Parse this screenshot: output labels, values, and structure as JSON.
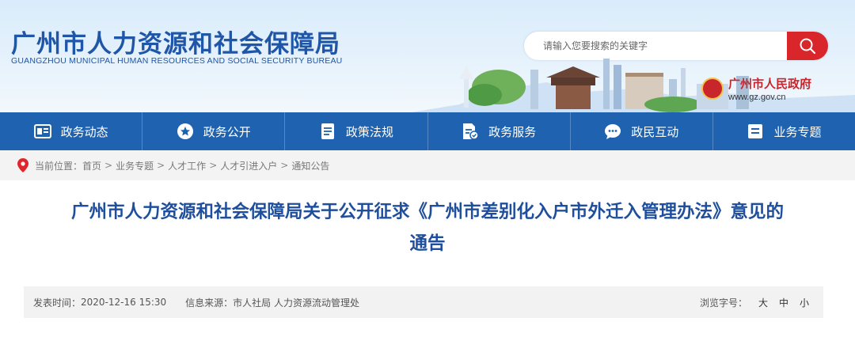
{
  "header": {
    "title": "广州市人力资源和社会保障局",
    "subtitle": "GUANGZHOU MUNICIPAL HUMAN RESOURCES AND SOCIAL SECURITY BUREAU",
    "search": {
      "placeholder": "请输入您要搜索的关键字",
      "button_icon": "search-icon"
    },
    "gov_badge": {
      "name": "广州市人民政府",
      "url": "www.gz.gov.cn",
      "icon": "emblem-icon"
    }
  },
  "nav": {
    "items": [
      {
        "label": "政务动态",
        "icon": "news-icon"
      },
      {
        "label": "政务公开",
        "icon": "star-icon"
      },
      {
        "label": "政策法规",
        "icon": "document-icon"
      },
      {
        "label": "政务服务",
        "icon": "service-icon"
      },
      {
        "label": "政民互动",
        "icon": "chat-icon"
      },
      {
        "label": "业务专题",
        "icon": "list-icon"
      }
    ]
  },
  "breadcrumb": {
    "prefix": "当前位置：",
    "items": [
      "首页",
      "业务专题",
      "人才工作",
      "人才引进入户",
      "通知公告"
    ],
    "separator": ">"
  },
  "article": {
    "title_line1": "广州市人力资源和社会保障局关于公开征求《广州市差别化入户市外迁入管理办法》意见的",
    "title_line2": "通告",
    "meta": {
      "date_label": "发表时间：",
      "date": "2020-12-16 15:30",
      "source_label": "信息来源：",
      "source": "市人社局 人力资源流动管理处",
      "font_size_label": "浏览字号：",
      "size_large": "大",
      "size_medium": "中",
      "size_small": "小"
    }
  },
  "colors": {
    "brand_blue": "#1f56a8",
    "nav_blue": "#1e62b0",
    "accent_red": "#d8262b"
  }
}
